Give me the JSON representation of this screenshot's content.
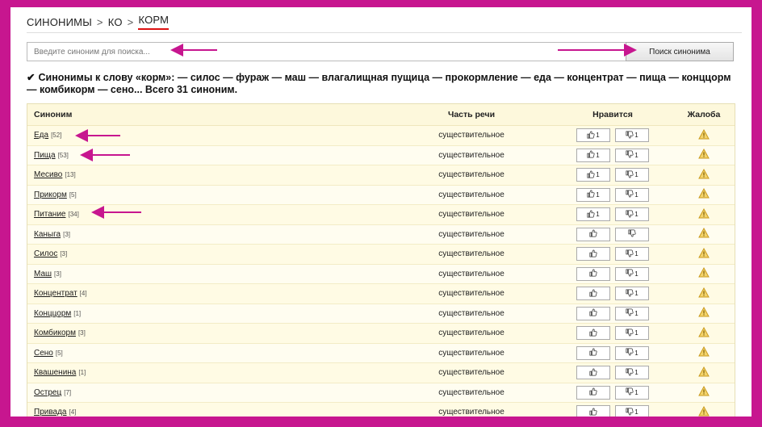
{
  "breadcrumb": {
    "items": [
      "СИНОНИМЫ",
      "КО",
      "КОРМ"
    ],
    "separator": ">"
  },
  "search": {
    "placeholder": "Введите синоним для поиска...",
    "button": "Поиск синонима"
  },
  "summary": {
    "check": "✔",
    "text": "Синонимы к слову «корм»: — силос — фураж — маш — влагалищная пущица — прокормление — еда — концентрат — пища — конццорм — комбикорм — сено... Всего 31 синоним."
  },
  "table": {
    "headers": {
      "word": "Синоним",
      "pos": "Часть речи",
      "like": "Нравится",
      "report": "Жалоба"
    },
    "rows": [
      {
        "word": "Еда",
        "count": "[52]",
        "pos": "существительное",
        "likes": "1",
        "dislikes": "1"
      },
      {
        "word": "Пища",
        "count": "[53]",
        "pos": "существительное",
        "likes": "1",
        "dislikes": "1"
      },
      {
        "word": "Месиво",
        "count": "[13]",
        "pos": "существительное",
        "likes": "1",
        "dislikes": "1"
      },
      {
        "word": "Прикорм",
        "count": "[5]",
        "pos": "существительное",
        "likes": "1",
        "dislikes": "1"
      },
      {
        "word": "Питание",
        "count": "[34]",
        "pos": "существительное",
        "likes": "1",
        "dislikes": "1"
      },
      {
        "word": "Каныга",
        "count": "[3]",
        "pos": "существительное",
        "likes": "",
        "dislikes": ""
      },
      {
        "word": "Силос",
        "count": "[3]",
        "pos": "существительное",
        "likes": "",
        "dislikes": "1"
      },
      {
        "word": "Маш",
        "count": "[3]",
        "pos": "существительное",
        "likes": "",
        "dislikes": "1"
      },
      {
        "word": "Концентрат",
        "count": "[4]",
        "pos": "существительное",
        "likes": "",
        "dislikes": "1"
      },
      {
        "word": "Конццорм",
        "count": "[1]",
        "pos": "существительное",
        "likes": "",
        "dislikes": "1"
      },
      {
        "word": "Комбикорм",
        "count": "[3]",
        "pos": "существительное",
        "likes": "",
        "dislikes": "1"
      },
      {
        "word": "Сено",
        "count": "[5]",
        "pos": "существительное",
        "likes": "",
        "dislikes": "1"
      },
      {
        "word": "Квашенина",
        "count": "[1]",
        "pos": "существительное",
        "likes": "",
        "dislikes": "1"
      },
      {
        "word": "Острец",
        "count": "[7]",
        "pos": "существительное",
        "likes": "",
        "dislikes": "1"
      },
      {
        "word": "Привада",
        "count": "[4]",
        "pos": "существительное",
        "likes": "",
        "dislikes": "1"
      }
    ]
  },
  "colors": {
    "frame": "#c7168f",
    "arrow": "#c7168f",
    "warning": "#e8b830",
    "accent_underline": "#d11111"
  },
  "icons": {
    "like": "thumbs-up-icon",
    "dislike": "thumbs-down-icon",
    "report": "warning-triangle-icon"
  }
}
